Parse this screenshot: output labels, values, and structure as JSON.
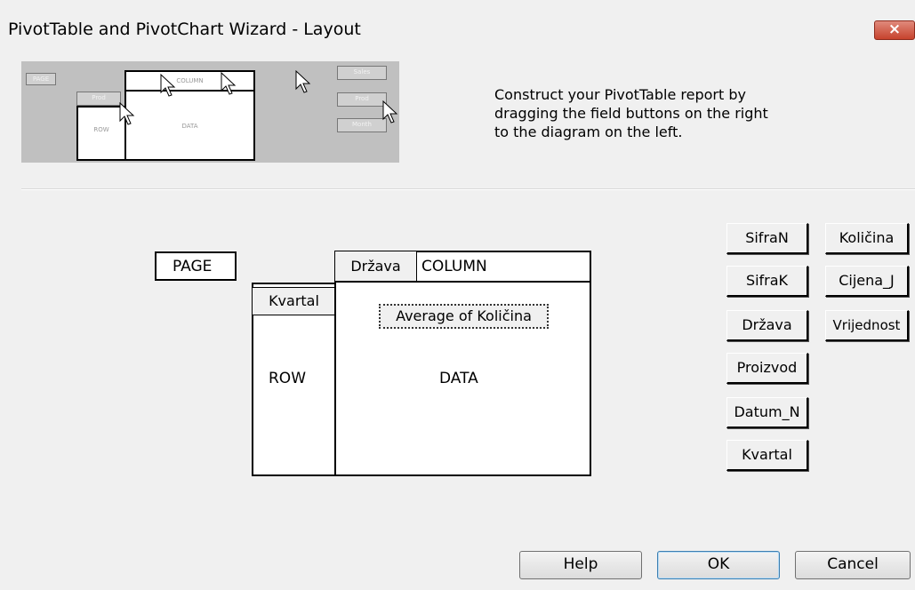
{
  "window": {
    "title": "PivotTable and PivotChart Wizard - Layout",
    "close_glyph": "×"
  },
  "illustration": {
    "page": "PAGE",
    "column": "COLUMN",
    "row": "ROW",
    "data": "DATA",
    "prod": "Prod",
    "field_buttons": [
      "Sales",
      "Prod",
      "Month"
    ]
  },
  "instructions": [
    "Construct your PivotTable report by",
    "dragging the field buttons on the right",
    "to the diagram on the left."
  ],
  "layout": {
    "page_label": "PAGE",
    "column_label": "COLUMN",
    "row_label": "ROW",
    "data_label": "DATA",
    "column_field": "Država",
    "row_field": "Kvartal",
    "data_field": "Average of Količina"
  },
  "fields": {
    "left": [
      "SifraN",
      "SifraK",
      "Država",
      "Proizvod",
      "Datum_N",
      "Kvartal"
    ],
    "right": [
      "Količina",
      "Cijena_J",
      "Vrijednost"
    ]
  },
  "buttons": {
    "help": "Help",
    "ok": "OK",
    "cancel": "Cancel"
  }
}
